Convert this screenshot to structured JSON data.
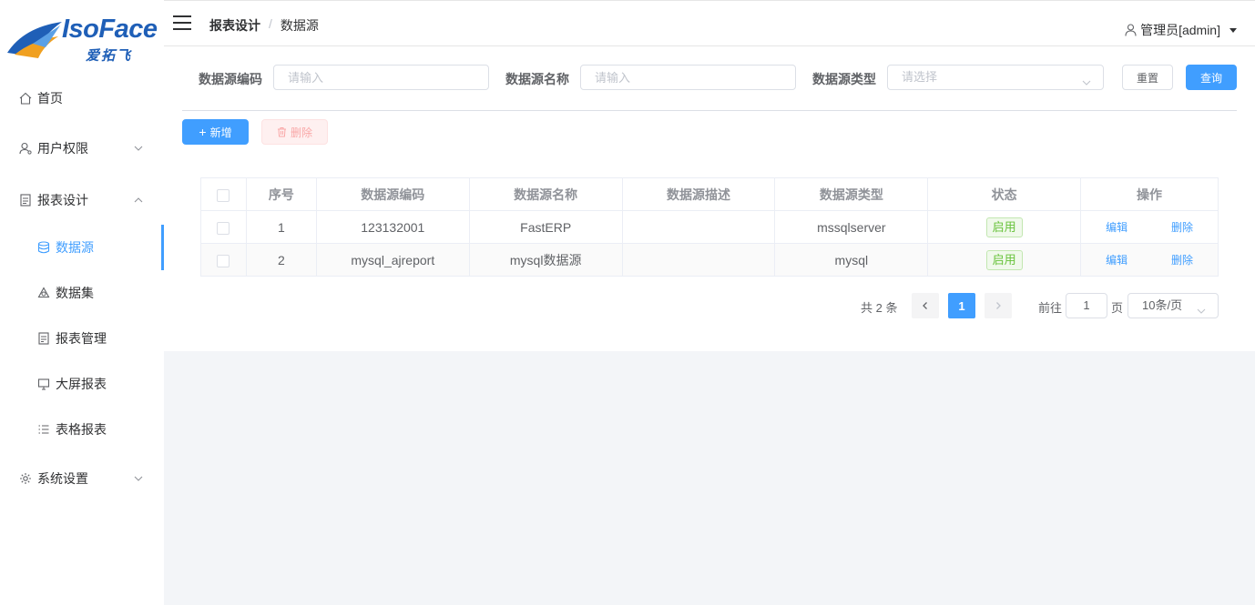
{
  "logo": {
    "text": "IsoFace",
    "sub": "爱拓飞"
  },
  "sidebar": {
    "items": [
      {
        "label": "首页"
      },
      {
        "label": "用户权限"
      },
      {
        "label": "报表设计"
      },
      {
        "label": "系统设置"
      }
    ],
    "sub_items": [
      {
        "label": "数据源",
        "active": true
      },
      {
        "label": "数据集"
      },
      {
        "label": "报表管理"
      },
      {
        "label": "大屏报表"
      },
      {
        "label": "表格报表"
      }
    ]
  },
  "header": {
    "breadcrumb": [
      "报表设计",
      "数据源"
    ],
    "user": "管理员[admin]"
  },
  "search": {
    "code_label": "数据源编码",
    "code_placeholder": "请输入",
    "name_label": "数据源名称",
    "name_placeholder": "请输入",
    "type_label": "数据源类型",
    "type_placeholder": "请选择",
    "reset": "重置",
    "query": "查询"
  },
  "toolbar": {
    "add": "新增",
    "delete": "删除"
  },
  "table": {
    "columns": [
      "序号",
      "数据源编码",
      "数据源名称",
      "数据源描述",
      "数据源类型",
      "状态",
      "操作"
    ],
    "rows": [
      {
        "index": "1",
        "code": "123132001",
        "name": "FastERP",
        "desc": "",
        "type": "mssqlserver",
        "status": "启用",
        "edit": "编辑",
        "delete": "删除"
      },
      {
        "index": "2",
        "code": "mysql_ajreport",
        "name": "mysql数据源",
        "desc": "",
        "type": "mysql",
        "status": "启用",
        "edit": "编辑",
        "delete": "删除"
      }
    ]
  },
  "pagination": {
    "total": "共 2 条",
    "current_page": "1",
    "goto_label": "前往",
    "goto_value": "1",
    "page_unit": "页",
    "page_size": "10条/页"
  },
  "colors": {
    "primary": "#409eff",
    "success": "#67c23a",
    "danger": "#f56c6c"
  }
}
